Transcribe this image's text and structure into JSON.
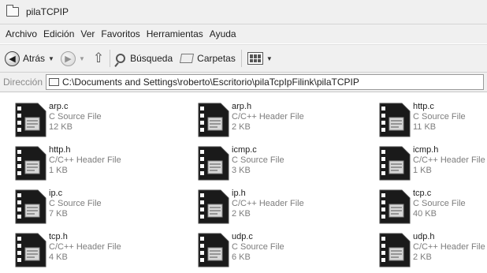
{
  "window": {
    "title": "pilaTCPIP"
  },
  "menu": [
    "Archivo",
    "Edición",
    "Ver",
    "Favoritos",
    "Herramientas",
    "Ayuda"
  ],
  "toolbar": {
    "back_label": "Atrás",
    "search_label": "Búsqueda",
    "folders_label": "Carpetas"
  },
  "address": {
    "label": "Dirección",
    "path": "C:\\Documents and Settings\\roberto\\Escritorio\\pilaTcpIpFilink\\pilaTCPIP"
  },
  "files": [
    {
      "name": "arp.c",
      "type": "C Source File",
      "size": "12 KB"
    },
    {
      "name": "arp.h",
      "type": "C/C++ Header File",
      "size": "2 KB"
    },
    {
      "name": "http.c",
      "type": "C Source File",
      "size": "11 KB"
    },
    {
      "name": "http.h",
      "type": "C/C++ Header File",
      "size": "1 KB"
    },
    {
      "name": "icmp.c",
      "type": "C Source File",
      "size": "3 KB"
    },
    {
      "name": "icmp.h",
      "type": "C/C++ Header File",
      "size": "1 KB"
    },
    {
      "name": "ip.c",
      "type": "C Source File",
      "size": "7 KB"
    },
    {
      "name": "ip.h",
      "type": "C/C++ Header File",
      "size": "2 KB"
    },
    {
      "name": "tcp.c",
      "type": "C Source File",
      "size": "40 KB"
    },
    {
      "name": "tcp.h",
      "type": "C/C++ Header File",
      "size": "4 KB"
    },
    {
      "name": "udp.c",
      "type": "C Source File",
      "size": "6 KB"
    },
    {
      "name": "udp.h",
      "type": "C/C++ Header File",
      "size": "2 KB"
    }
  ]
}
